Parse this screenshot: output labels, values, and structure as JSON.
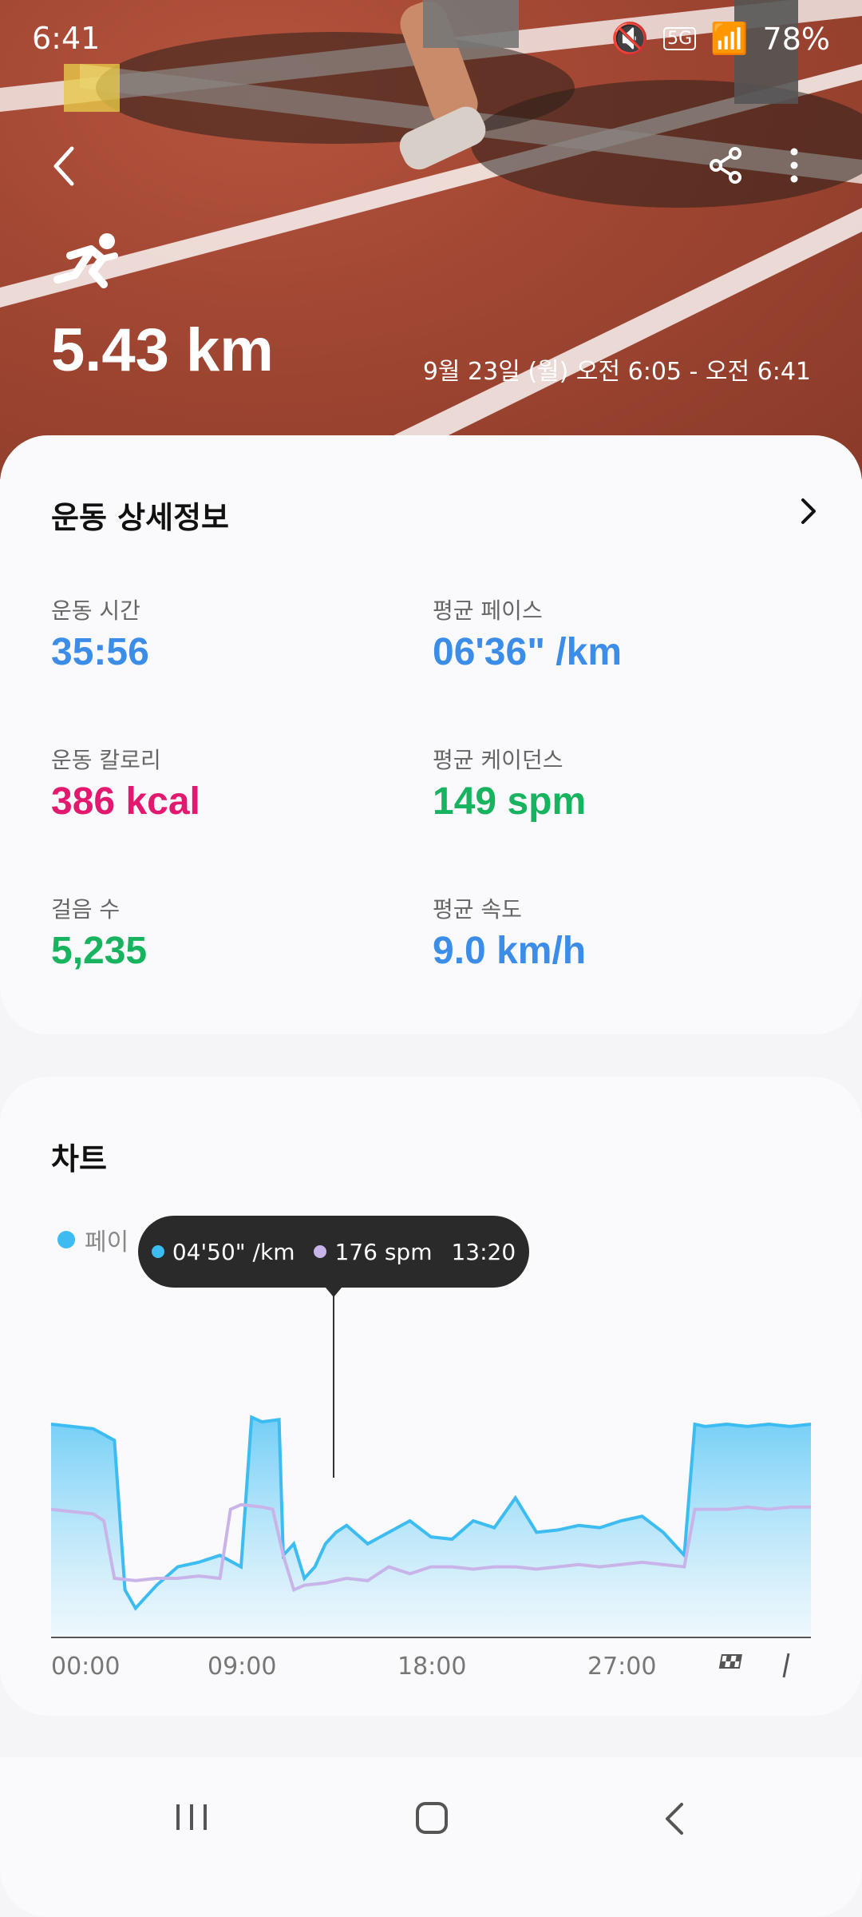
{
  "status": {
    "time": "6:41",
    "battery": "78%",
    "network": "5G"
  },
  "hero": {
    "distance": "5.43 km",
    "date_range": "9월 23일 (월) 오전 6:05 - 오전 6:41"
  },
  "details": {
    "title": "운동 상세정보",
    "metrics": [
      {
        "label": "운동 시간",
        "value": "35:56",
        "unit": "",
        "color": "#3c8de8"
      },
      {
        "label": "평균 페이스",
        "value": "06'36\"",
        "unit": "/km",
        "color": "#3c8de8"
      },
      {
        "label": "운동 칼로리",
        "value": "386",
        "unit": "kcal",
        "color": "#e3186f"
      },
      {
        "label": "평균 케이던스",
        "value": "149",
        "unit": "spm",
        "color": "#17b35f"
      },
      {
        "label": "걸음 수",
        "value": "5,235",
        "unit": "",
        "color": "#17b35f"
      },
      {
        "label": "평균 속도",
        "value": "9.0",
        "unit": "km/h",
        "color": "#3c8de8"
      }
    ]
  },
  "chart": {
    "title": "차트",
    "legend_label": "페이",
    "tooltip": {
      "pace": "04'50\" /km",
      "cadence": "176 spm",
      "time": "13:20"
    },
    "x_ticks": [
      "00:00",
      "09:00",
      "18:00",
      "27:00"
    ],
    "colors": {
      "pace": "#3dbcf2",
      "cadence": "#c9b4ea"
    }
  },
  "chart_data": {
    "type": "area",
    "x_ticks": [
      "00:00",
      "09:00",
      "18:00",
      "27:00"
    ],
    "series": [
      {
        "x": [
          0,
          2,
          3,
          3.5,
          4,
          5,
          6,
          7,
          8,
          9,
          9.5,
          10,
          10.8,
          11,
          11.5,
          12,
          12.5,
          13,
          13.5,
          14,
          15,
          16,
          17,
          18,
          19,
          20,
          21,
          22,
          23,
          24,
          25,
          26,
          27,
          28,
          29,
          30,
          30.5,
          31,
          32,
          33,
          34,
          35,
          36
        ],
        "values": [
          0.92,
          0.9,
          0.85,
          0.2,
          0.12,
          0.22,
          0.3,
          0.32,
          0.35,
          0.3,
          0.95,
          0.93,
          0.94,
          0.35,
          0.4,
          0.25,
          0.3,
          0.4,
          0.45,
          0.48,
          0.4,
          0.45,
          0.5,
          0.43,
          0.42,
          0.5,
          0.47,
          0.6,
          0.45,
          0.46,
          0.48,
          0.47,
          0.5,
          0.52,
          0.45,
          0.35,
          0.92,
          0.91,
          0.92,
          0.91,
          0.92,
          0.91,
          0.92
        ]
      },
      {
        "x": [
          0,
          2,
          2.5,
          3,
          4,
          5,
          6,
          7,
          8,
          8.5,
          9,
          10,
          10.5,
          11,
          11.5,
          12,
          13,
          14,
          15,
          16,
          17,
          18,
          19,
          20,
          21,
          22,
          23,
          24,
          25,
          26,
          27,
          28,
          29,
          30,
          30.5,
          31,
          32,
          33,
          34,
          35,
          36
        ],
        "values": [
          0.55,
          0.53,
          0.5,
          0.25,
          0.24,
          0.25,
          0.25,
          0.26,
          0.25,
          0.55,
          0.57,
          0.56,
          0.55,
          0.35,
          0.2,
          0.22,
          0.23,
          0.25,
          0.24,
          0.3,
          0.27,
          0.3,
          0.3,
          0.29,
          0.3,
          0.3,
          0.29,
          0.3,
          0.31,
          0.3,
          0.31,
          0.32,
          0.31,
          0.3,
          0.55,
          0.55,
          0.55,
          0.56,
          0.55,
          0.56,
          0.56
        ]
      }
    ],
    "xlim": [
      0,
      36
    ]
  }
}
